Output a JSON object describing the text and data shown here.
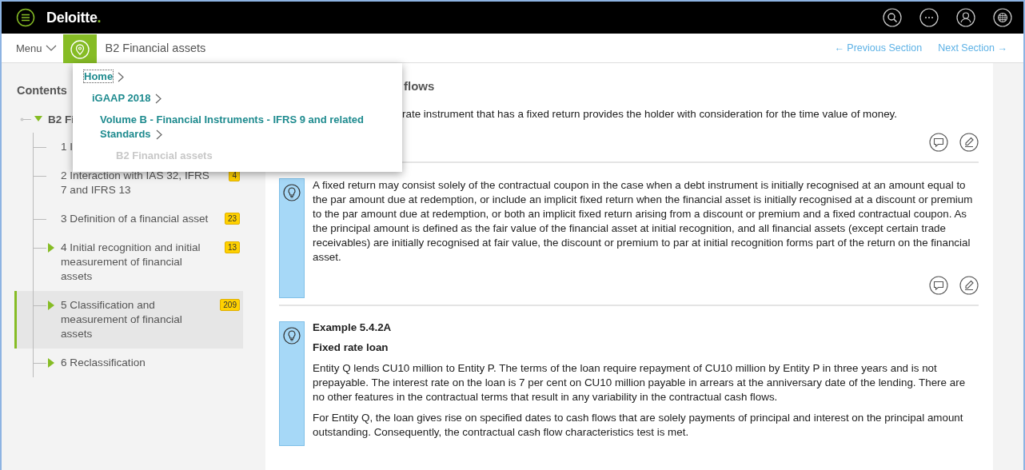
{
  "topbar": {
    "logo": "Deloitte",
    "logo_mark": "."
  },
  "nav": {
    "menu": "Menu",
    "title": "B2 Financial assets",
    "previous": "← Previous Section",
    "next": "Next Section →"
  },
  "breadcrumb": [
    {
      "label": "Home",
      "kind": "link",
      "focused": true,
      "children": [
        {
          "label": "iGAAP 2018",
          "kind": "link",
          "focused": false,
          "children": [
            {
              "label": "Volume B - Financial Instruments - IFRS 9 and related Standards",
              "kind": "link",
              "focused": false,
              "children": [
                {
                  "label": "B2 Financial assets",
                  "kind": "current",
                  "focused": false
                }
              ]
            }
          ]
        }
      ]
    }
  ],
  "sidebar": {
    "title": "Contents",
    "tree": [
      {
        "label": "B2 Fi",
        "expanded": true,
        "selected": false,
        "children": [
          {
            "label": "1 I",
            "kind": "leaf",
            "selected": false
          },
          {
            "label": "2 Interaction with IAS 32, IFRS 7 and IFRS 13",
            "kind": "leaf",
            "count": "4",
            "selected": false
          },
          {
            "label": "3 Definition of a financial asset",
            "kind": "leaf",
            "count": "23",
            "selected": false
          },
          {
            "label": "4 Initial recognition and initial measurement of financial assets",
            "kind": "branch",
            "count": "13",
            "selected": false
          },
          {
            "label": "5 Classification and measurement of financial assets",
            "kind": "branch",
            "count": "209",
            "selected": true
          },
          {
            "label": "6 Reclassification",
            "kind": "branch",
            "selected": false
          }
        ]
      }
    ]
  },
  "sections": [
    {
      "kind": "text",
      "heading": "flows",
      "paragraphs": [
        "rate instrument that has a fixed return provides the holder with consideration for the time value of money."
      ],
      "tools": true
    },
    {
      "kind": "note",
      "paragraphs": [
        "A fixed return may consist solely of the contractual coupon in the case when a debt instrument is initially recognised at an amount equal to the par amount due at redemption, or include an implicit fixed return when the financial asset is initially recognised at a discount or premium to the par amount due at redemption, or both an implicit fixed return arising from a discount or premium and a fixed contractual coupon. As the principal amount is defined as the fair value of the financial asset at initial recognition, and all financial assets (except certain trade receivables) are initially recognised at fair value, the discount or premium to par at initial recognition forms part of the return on the financial asset."
      ],
      "tools": true
    },
    {
      "kind": "note",
      "heading": "Example 5.4.2A",
      "subheading": "Fixed rate loan",
      "paragraphs": [
        "Entity Q lends CU10 million to Entity P. The terms of the loan require repayment of CU10 million by Entity P in three years and is not prepayable. The interest rate on the loan is 7 per cent on CU10 million payable in arrears at the anniversary date of the lending. There are no other features in the contractual terms that result in any variability in the contractual cash flows.",
        "For Entity Q, the loan gives rise on specified dates to cash flows that are solely payments of principal and interest on the principal amount outstanding. Consequently, the contractual cash flow characteristics test is met."
      ],
      "tools": false
    }
  ]
}
